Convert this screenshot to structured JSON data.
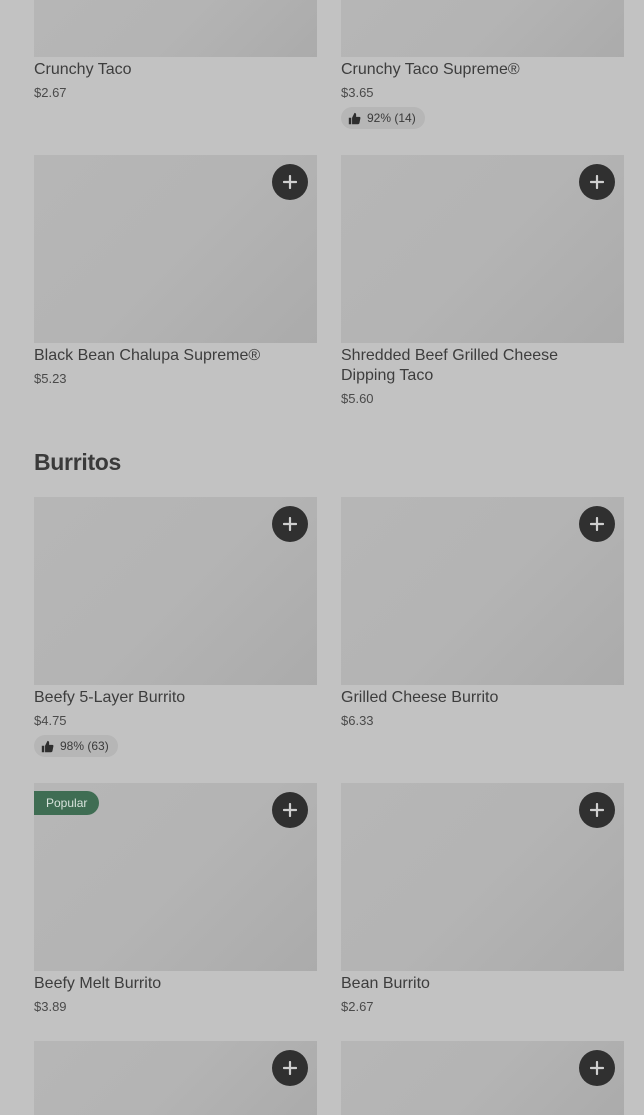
{
  "items": [
    {
      "name": "Crunchy Taco",
      "price": "$2.67"
    },
    {
      "name": "Crunchy Taco Supreme®",
      "price": "$3.65",
      "rating": "92% (14)"
    },
    {
      "name": "Black Bean Chalupa Supreme®",
      "price": "$5.23"
    },
    {
      "name": "Shredded Beef Grilled Cheese Dipping Taco",
      "price": "$5.60"
    },
    {
      "name": "Beefy 5-Layer Burrito",
      "price": "$4.75",
      "rating": "98% (63)"
    },
    {
      "name": "Grilled Cheese Burrito",
      "price": "$6.33"
    },
    {
      "name": "Beefy Melt Burrito",
      "price": "$3.89",
      "badge": "Popular"
    },
    {
      "name": "Bean Burrito",
      "price": "$2.67"
    }
  ],
  "sections": {
    "burritos_title": "Burritos"
  },
  "icons": {
    "add": "plus-icon",
    "rating": "thumbs-up-icon"
  },
  "colors": {
    "background": "#c2c2c2",
    "add_button": "#303030",
    "popular_badge": "#3f6d53"
  }
}
